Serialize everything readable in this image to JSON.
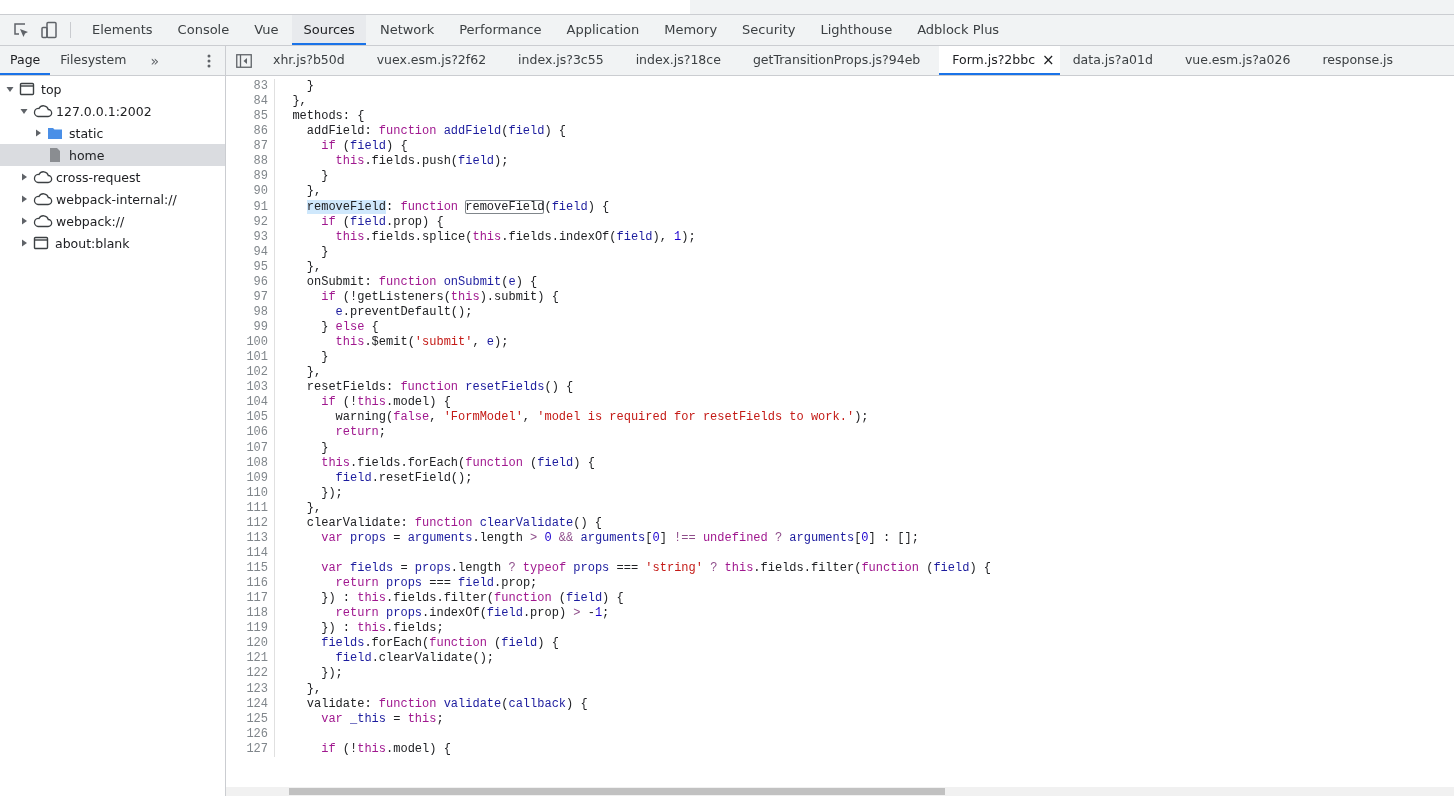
{
  "main_tabs": [
    {
      "label": "Elements",
      "selected": false
    },
    {
      "label": "Console",
      "selected": false
    },
    {
      "label": "Vue",
      "selected": false
    },
    {
      "label": "Sources",
      "selected": true
    },
    {
      "label": "Network",
      "selected": false
    },
    {
      "label": "Performance",
      "selected": false
    },
    {
      "label": "Application",
      "selected": false
    },
    {
      "label": "Memory",
      "selected": false
    },
    {
      "label": "Security",
      "selected": false
    },
    {
      "label": "Lighthouse",
      "selected": false
    },
    {
      "label": "Adblock Plus",
      "selected": false
    }
  ],
  "navigator": {
    "tabs": [
      {
        "label": "Page",
        "selected": true
      },
      {
        "label": "Filesystem",
        "selected": false
      }
    ],
    "more": "»",
    "tree": [
      {
        "label": "top",
        "kind": "frame",
        "expanded": true,
        "selected": false,
        "children": [
          {
            "label": "127.0.0.1:2002",
            "kind": "cloud",
            "expanded": true,
            "selected": false,
            "children": [
              {
                "label": "static",
                "kind": "folder",
                "expanded": false,
                "selected": false
              },
              {
                "label": "home",
                "kind": "file",
                "selected": true
              }
            ]
          },
          {
            "label": "cross-request",
            "kind": "cloud",
            "expanded": false,
            "selected": false
          },
          {
            "label": "webpack-internal://",
            "kind": "cloud",
            "expanded": false,
            "selected": false
          },
          {
            "label": "webpack://",
            "kind": "cloud",
            "expanded": false,
            "selected": false
          },
          {
            "label": "about:blank",
            "kind": "frame",
            "expanded": false,
            "selected": false
          }
        ]
      }
    ]
  },
  "file_tabs": [
    {
      "label": "xhr.js?b50d",
      "selected": false
    },
    {
      "label": "vuex.esm.js?2f62",
      "selected": false
    },
    {
      "label": "index.js?3c55",
      "selected": false
    },
    {
      "label": "index.js?18ce",
      "selected": false
    },
    {
      "label": "getTransitionProps.js?94eb",
      "selected": false
    },
    {
      "label": "Form.js?2bbc",
      "selected": true,
      "close": "×"
    },
    {
      "label": "data.js?a01d",
      "selected": false
    },
    {
      "label": "vue.esm.js?a026",
      "selected": false
    },
    {
      "label": "response.js",
      "selected": false
    }
  ],
  "code": [
    {
      "n": "83",
      "tokens": [
        {
          "text": "    }"
        }
      ]
    },
    {
      "n": "84",
      "tokens": [
        {
          "text": "  },"
        }
      ]
    },
    {
      "n": "85",
      "tokens": [
        {
          "text": "  methods: {"
        }
      ]
    },
    {
      "n": "86",
      "tokens": [
        {
          "text": "    addField: "
        },
        {
          "kind": "kw",
          "text": "function"
        },
        {
          "kind": "var",
          "text": " addField"
        },
        {
          "text": "("
        },
        {
          "kind": "var",
          "text": "field"
        },
        {
          "text": ") {"
        }
      ]
    },
    {
      "n": "87",
      "tokens": [
        {
          "kind": "kw",
          "text": "      if"
        },
        {
          "text": " ("
        },
        {
          "kind": "var",
          "text": "field"
        },
        {
          "text": ") {"
        }
      ]
    },
    {
      "n": "88",
      "tokens": [
        {
          "kind": "kw",
          "text": "        this"
        },
        {
          "text": ".fields.push("
        },
        {
          "kind": "var",
          "text": "field"
        },
        {
          "text": ");"
        }
      ]
    },
    {
      "n": "89",
      "tokens": [
        {
          "text": "      }"
        }
      ]
    },
    {
      "n": "90",
      "tokens": [
        {
          "text": "    },"
        }
      ]
    },
    {
      "n": "91",
      "tokens": [
        {
          "kind": "sel",
          "text": "    removeField"
        },
        {
          "text": ": "
        },
        {
          "kind": "kw",
          "text": "function"
        },
        {
          "kind": "box",
          "text": " removeField"
        },
        {
          "text": "("
        },
        {
          "kind": "var",
          "text": "field"
        },
        {
          "text": ") {"
        }
      ]
    },
    {
      "n": "92",
      "tokens": [
        {
          "kind": "kw",
          "text": "      if"
        },
        {
          "text": " ("
        },
        {
          "kind": "var",
          "text": "field"
        },
        {
          "text": ".prop) {"
        }
      ]
    },
    {
      "n": "93",
      "tokens": [
        {
          "kind": "kw",
          "text": "        this"
        },
        {
          "text": ".fields.splice("
        },
        {
          "kind": "kw",
          "text": "this"
        },
        {
          "text": ".fields.indexOf("
        },
        {
          "kind": "var",
          "text": "field"
        },
        {
          "text": "), "
        },
        {
          "kind": "num",
          "text": "1"
        },
        {
          "text": ");"
        }
      ]
    },
    {
      "n": "94",
      "tokens": [
        {
          "text": "      }"
        }
      ]
    },
    {
      "n": "95",
      "tokens": [
        {
          "text": "    },"
        }
      ]
    },
    {
      "n": "96",
      "tokens": [
        {
          "text": "    onSubmit: "
        },
        {
          "kind": "kw",
          "text": "function"
        },
        {
          "kind": "var",
          "text": " onSubmit"
        },
        {
          "text": "("
        },
        {
          "kind": "var",
          "text": "e"
        },
        {
          "text": ") {"
        }
      ]
    },
    {
      "n": "97",
      "tokens": [
        {
          "kind": "kw",
          "text": "      if"
        },
        {
          "text": " (!getListeners("
        },
        {
          "kind": "kw",
          "text": "this"
        },
        {
          "text": ").submit) {"
        }
      ]
    },
    {
      "n": "98",
      "tokens": [
        {
          "kind": "var",
          "text": "        e"
        },
        {
          "text": ".preventDefault();"
        }
      ]
    },
    {
      "n": "99",
      "tokens": [
        {
          "text": "      } "
        },
        {
          "kind": "kw",
          "text": "else"
        },
        {
          "text": " {"
        }
      ]
    },
    {
      "n": "100",
      "tokens": [
        {
          "kind": "kw",
          "text": "        this"
        },
        {
          "text": ".$emit("
        },
        {
          "kind": "str",
          "text": "'submit'"
        },
        {
          "text": ", "
        },
        {
          "kind": "var",
          "text": "e"
        },
        {
          "text": ");"
        }
      ]
    },
    {
      "n": "101",
      "tokens": [
        {
          "text": "      }"
        }
      ]
    },
    {
      "n": "102",
      "tokens": [
        {
          "text": "    },"
        }
      ]
    },
    {
      "n": "103",
      "tokens": [
        {
          "text": "    resetFields: "
        },
        {
          "kind": "kw",
          "text": "function"
        },
        {
          "kind": "var",
          "text": " resetFields"
        },
        {
          "text": "() {"
        }
      ]
    },
    {
      "n": "104",
      "tokens": [
        {
          "kind": "kw",
          "text": "      if"
        },
        {
          "text": " (!"
        },
        {
          "kind": "kw",
          "text": "this"
        },
        {
          "text": ".model) {"
        }
      ]
    },
    {
      "n": "105",
      "tokens": [
        {
          "text": "        warning("
        },
        {
          "kind": "kw",
          "text": "false"
        },
        {
          "text": ", "
        },
        {
          "kind": "str",
          "text": "'FormModel'"
        },
        {
          "text": ", "
        },
        {
          "kind": "str",
          "text": "'model is required for resetFields to work.'"
        },
        {
          "text": ");"
        }
      ]
    },
    {
      "n": "106",
      "tokens": [
        {
          "kind": "kw",
          "text": "        return"
        },
        {
          "text": ";"
        }
      ]
    },
    {
      "n": "107",
      "tokens": [
        {
          "text": "      }"
        }
      ]
    },
    {
      "n": "108",
      "tokens": [
        {
          "kind": "kw",
          "text": "      this"
        },
        {
          "text": ".fields.forEach("
        },
        {
          "kind": "kw",
          "text": "function"
        },
        {
          "text": " ("
        },
        {
          "kind": "var",
          "text": "field"
        },
        {
          "text": ") {"
        }
      ]
    },
    {
      "n": "109",
      "tokens": [
        {
          "kind": "var",
          "text": "        field"
        },
        {
          "text": ".resetField();"
        }
      ]
    },
    {
      "n": "110",
      "tokens": [
        {
          "text": "      });"
        }
      ]
    },
    {
      "n": "111",
      "tokens": [
        {
          "text": "    },"
        }
      ]
    },
    {
      "n": "112",
      "tokens": [
        {
          "text": "    clearValidate: "
        },
        {
          "kind": "kw",
          "text": "function"
        },
        {
          "kind": "var",
          "text": " clearValidate"
        },
        {
          "text": "() {"
        }
      ]
    },
    {
      "n": "113",
      "tokens": [
        {
          "kind": "kw",
          "text": "      var"
        },
        {
          "kind": "var",
          "text": " props"
        },
        {
          "text": " = "
        },
        {
          "kind": "var",
          "text": "arguments"
        },
        {
          "text": ".length "
        },
        {
          "kind": "op",
          "text": ">"
        },
        {
          "kind": "num",
          "text": " 0"
        },
        {
          "kind": "op",
          "text": " &&"
        },
        {
          "kind": "var",
          "text": " arguments"
        },
        {
          "text": "["
        },
        {
          "kind": "num",
          "text": "0"
        },
        {
          "text": "] "
        },
        {
          "kind": "op",
          "text": "!=="
        },
        {
          "kind": "kw",
          "text": " undefined"
        },
        {
          "kind": "op",
          "text": " ?"
        },
        {
          "kind": "var",
          "text": " arguments"
        },
        {
          "text": "["
        },
        {
          "kind": "num",
          "text": "0"
        },
        {
          "text": "] : [];"
        }
      ]
    },
    {
      "n": "114"
    },
    {
      "n": "115",
      "tokens": [
        {
          "kind": "kw",
          "text": "      var"
        },
        {
          "kind": "var",
          "text": " fields"
        },
        {
          "text": " = "
        },
        {
          "kind": "var",
          "text": "props"
        },
        {
          "text": ".length "
        },
        {
          "kind": "op",
          "text": "?"
        },
        {
          "kind": "kw",
          "text": " typeof"
        },
        {
          "kind": "var",
          "text": " props"
        },
        {
          "text": " === "
        },
        {
          "kind": "str",
          "text": "'string'"
        },
        {
          "kind": "op",
          "text": " ?"
        },
        {
          "kind": "kw",
          "text": " this"
        },
        {
          "text": ".fields.filter("
        },
        {
          "kind": "kw",
          "text": "function"
        },
        {
          "text": " ("
        },
        {
          "kind": "var",
          "text": "field"
        },
        {
          "text": ") {"
        }
      ]
    },
    {
      "n": "116",
      "tokens": [
        {
          "kind": "kw",
          "text": "        return"
        },
        {
          "kind": "var",
          "text": " props"
        },
        {
          "text": " === "
        },
        {
          "kind": "var",
          "text": "field"
        },
        {
          "text": ".prop;"
        }
      ]
    },
    {
      "n": "117",
      "tokens": [
        {
          "text": "      }) : "
        },
        {
          "kind": "kw",
          "text": "this"
        },
        {
          "text": ".fields.filter("
        },
        {
          "kind": "kw",
          "text": "function"
        },
        {
          "text": " ("
        },
        {
          "kind": "var",
          "text": "field"
        },
        {
          "text": ") {"
        }
      ]
    },
    {
      "n": "118",
      "tokens": [
        {
          "kind": "kw",
          "text": "        return"
        },
        {
          "kind": "var",
          "text": " props"
        },
        {
          "text": ".indexOf("
        },
        {
          "kind": "var",
          "text": "field"
        },
        {
          "text": ".prop) "
        },
        {
          "kind": "op",
          "text": ">"
        },
        {
          "text": " -"
        },
        {
          "kind": "num",
          "text": "1"
        },
        {
          "text": ";"
        }
      ]
    },
    {
      "n": "119",
      "tokens": [
        {
          "text": "      }) : "
        },
        {
          "kind": "kw",
          "text": "this"
        },
        {
          "text": ".fields;"
        }
      ]
    },
    {
      "n": "120",
      "tokens": [
        {
          "kind": "var",
          "text": "      fields"
        },
        {
          "text": ".forEach("
        },
        {
          "kind": "kw",
          "text": "function"
        },
        {
          "text": " ("
        },
        {
          "kind": "var",
          "text": "field"
        },
        {
          "text": ") {"
        }
      ]
    },
    {
      "n": "121",
      "tokens": [
        {
          "kind": "var",
          "text": "        field"
        },
        {
          "text": ".clearValidate();"
        }
      ]
    },
    {
      "n": "122",
      "tokens": [
        {
          "text": "      });"
        }
      ]
    },
    {
      "n": "123",
      "tokens": [
        {
          "text": "    },"
        }
      ]
    },
    {
      "n": "124",
      "tokens": [
        {
          "text": "    validate: "
        },
        {
          "kind": "kw",
          "text": "function"
        },
        {
          "kind": "var",
          "text": " validate"
        },
        {
          "text": "("
        },
        {
          "kind": "var",
          "text": "callback"
        },
        {
          "text": ") {"
        }
      ]
    },
    {
      "n": "125",
      "tokens": [
        {
          "kind": "kw",
          "text": "      var"
        },
        {
          "kind": "var",
          "text": " _this"
        },
        {
          "text": " = "
        },
        {
          "kind": "kw",
          "text": "this"
        },
        {
          "text": ";"
        }
      ]
    },
    {
      "n": "126"
    },
    {
      "n": "127",
      "tokens": [
        {
          "kind": "kw",
          "text": "      if"
        },
        {
          "text": " (!"
        },
        {
          "kind": "kw",
          "text": "this"
        },
        {
          "text": ".model) {"
        }
      ]
    }
  ]
}
